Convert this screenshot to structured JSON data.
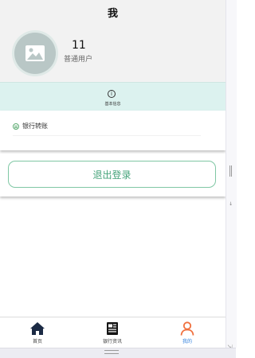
{
  "header": {
    "title": "我"
  },
  "profile": {
    "user_id": "11",
    "user_type": "普通用户"
  },
  "info_bar": {
    "label": "基本信息"
  },
  "list": {
    "items": [
      {
        "label": "银行转账"
      }
    ]
  },
  "logout": {
    "label": "退出登录"
  },
  "tabbar": {
    "tabs": [
      {
        "label": "首页",
        "icon": "home-icon",
        "active": false
      },
      {
        "label": "银行资讯",
        "icon": "news-icon",
        "active": false
      },
      {
        "label": "我的",
        "icon": "person-icon",
        "active": true
      }
    ]
  },
  "colors": {
    "accent": "#45a37a",
    "active_tab": "#2f7fdc",
    "active_icon": "#f0703e",
    "info_bar_bg": "#dcf2ef",
    "header_bg": "#f2f2f2"
  }
}
